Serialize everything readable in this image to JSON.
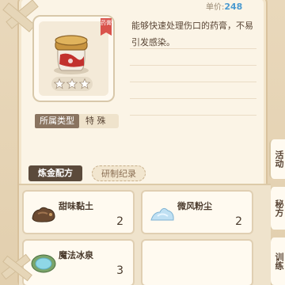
{
  "price": {
    "label": "单价:",
    "value": "248"
  },
  "item": {
    "tag": "药膏",
    "stars": 3,
    "description": "能够快速处理伤口的药膏，不易引发感染。"
  },
  "category": {
    "label": "所属类型",
    "value": "特 殊"
  },
  "tabs": [
    {
      "label": "炼金配方",
      "active": true
    },
    {
      "label": "研制纪录",
      "active": false
    }
  ],
  "ingredients": [
    {
      "name": "甜味黏土",
      "count": "2",
      "icon": "clay-icon"
    },
    {
      "name": "微风粉尘",
      "count": "2",
      "icon": "dust-icon"
    },
    {
      "name": "魔法冰泉",
      "count": "3",
      "icon": "spring-icon"
    }
  ],
  "side_tabs": [
    {
      "label": "活动"
    },
    {
      "label": "秘方"
    },
    {
      "label": "训练"
    }
  ],
  "colors": {
    "accent": "#4b9ad0",
    "tab_active": "#5b4a3b",
    "tag": "#d9534c"
  }
}
